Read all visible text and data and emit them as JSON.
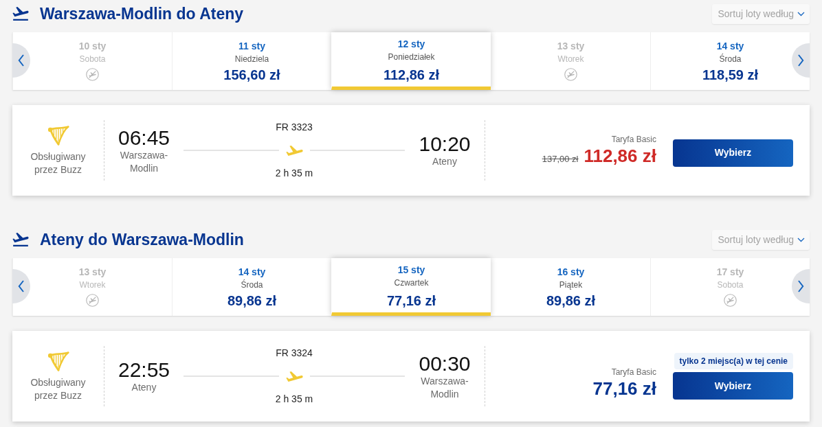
{
  "sections": [
    {
      "title": "Warszawa-Modlin do Ateny",
      "sort_label": "Sortuj loty według",
      "dates": [
        {
          "date": "10 sty",
          "day": "Sobota",
          "available": false,
          "selected": false
        },
        {
          "date": "11 sty",
          "day": "Niedziela",
          "price": "156,60 zł",
          "available": true,
          "selected": false
        },
        {
          "date": "12 sty",
          "day": "Poniedziałek",
          "price": "112,86 zł",
          "available": true,
          "selected": true
        },
        {
          "date": "13 sty",
          "day": "Wtorek",
          "available": false,
          "selected": false
        },
        {
          "date": "14 sty",
          "day": "Środa",
          "price": "118,59 zł",
          "available": true,
          "selected": false
        }
      ],
      "flight": {
        "operator": "Obsługiwany przez Buzz",
        "departure": {
          "time": "06:45",
          "city": "Warszawa-Modlin"
        },
        "flight_number": "FR 3323",
        "duration": "2 h 35 m",
        "arrival": {
          "time": "10:20",
          "city": "Ateny"
        },
        "fare": "Taryfa Basic",
        "old_price": "137,00 zł",
        "price": "112,86 zł",
        "button": "Wybierz"
      }
    },
    {
      "title": "Ateny do Warszawa-Modlin",
      "sort_label": "Sortuj loty według",
      "dates": [
        {
          "date": "13 sty",
          "day": "Wtorek",
          "available": false,
          "selected": false
        },
        {
          "date": "14 sty",
          "day": "Środa",
          "price": "89,86 zł",
          "available": true,
          "selected": false
        },
        {
          "date": "15 sty",
          "day": "Czwartek",
          "price": "77,16 zł",
          "available": true,
          "selected": true
        },
        {
          "date": "16 sty",
          "day": "Piątek",
          "price": "89,86 zł",
          "available": true,
          "selected": false
        },
        {
          "date": "17 sty",
          "day": "Sobota",
          "available": false,
          "selected": false
        }
      ],
      "flight": {
        "operator": "Obsługiwany przez Buzz",
        "departure": {
          "time": "22:55",
          "city": "Ateny"
        },
        "flight_number": "FR 3324",
        "duration": "2 h 35 m",
        "arrival": {
          "time": "00:30",
          "city": "Warszawa-Modlin"
        },
        "fare": "Taryfa Basic",
        "price": "77,16 zł",
        "seats_notice": "tylko 2 miejsc(a) w tej cenie",
        "button": "Wybierz"
      }
    }
  ]
}
